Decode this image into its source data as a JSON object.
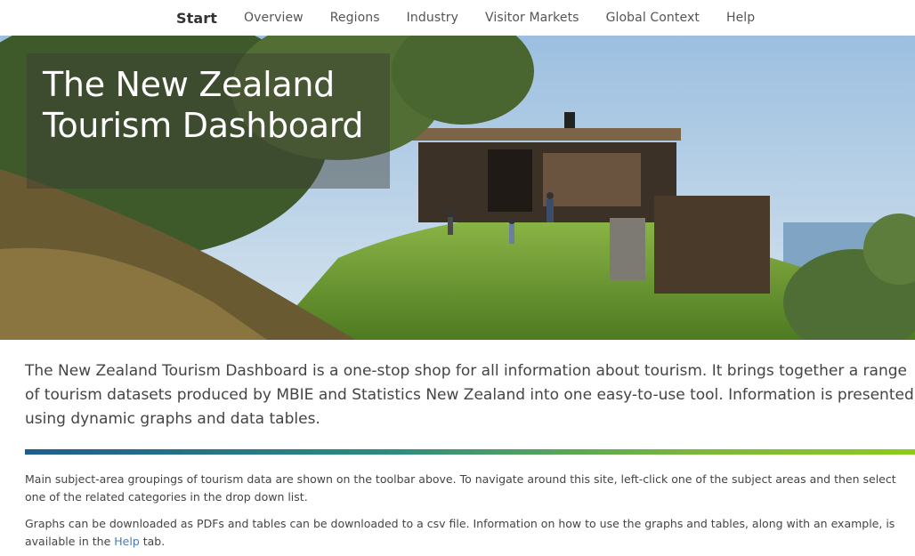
{
  "nav": {
    "items": [
      {
        "label": "Start",
        "active": true
      },
      {
        "label": "Overview"
      },
      {
        "label": "Regions"
      },
      {
        "label": "Industry"
      },
      {
        "label": "Visitor Markets"
      },
      {
        "label": "Global Context"
      },
      {
        "label": "Help"
      }
    ]
  },
  "hero": {
    "title_line1": "The New Zealand",
    "title_line2": "Tourism Dashboard"
  },
  "intro": "The New Zealand Tourism Dashboard is a one-stop shop for all information about tourism. It brings together a range of tourism datasets produced by MBIE and Statistics New Zealand into one easy-to-use tool. Information is presented using dynamic graphs and data tables.",
  "paragraph1": "Main subject-area groupings of tourism data are shown on the toolbar above. To navigate around this site, left-click one of the subject areas and then select one of the related categories in the drop down list.",
  "paragraph2": {
    "before": "Graphs can be downloaded as PDFs and tables can be downloaded to a csv file. Information on how to use the graphs and tables, along with an example, is available in the ",
    "link": "Help",
    "after": " tab."
  },
  "colors": {
    "gradient_start": "#1f5e8a",
    "gradient_end": "#8ccb1c",
    "link": "#4a7bb0"
  }
}
